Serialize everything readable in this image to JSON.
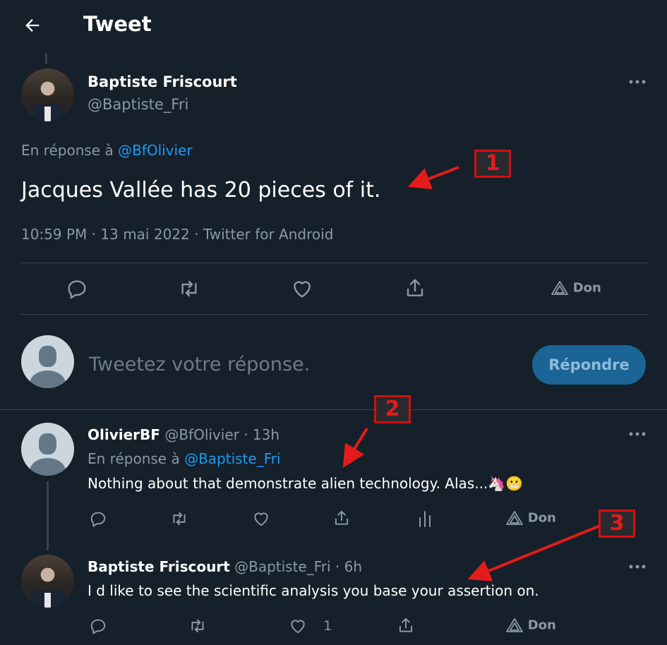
{
  "header": {
    "title": "Tweet"
  },
  "main_tweet": {
    "author_name": "Baptiste Friscourt",
    "author_handle": "@Baptiste_Fri",
    "reply_prefix": "En réponse à",
    "reply_to": "@BfOlivier",
    "text": "Jacques Vallée has 20 pieces of it.",
    "meta": "10:59 PM · 13 mai 2022 · Twitter for Android",
    "actions": {
      "tip_label": "Don"
    }
  },
  "composer": {
    "placeholder": "Tweetez votre réponse.",
    "reply_button": "Répondre"
  },
  "replies": [
    {
      "author_name": "OlivierBF",
      "author_handle": "@BfOlivier",
      "time": "· 13h",
      "reply_prefix": "En réponse à",
      "reply_to": "@Baptiste_Fri",
      "text": "Nothing about that demonstrate alien technology. Alas...",
      "emoji": "🦄😬",
      "tip_label": "Don",
      "like_count": ""
    },
    {
      "author_name": "Baptiste Friscourt",
      "author_handle": "@Baptiste_Fri",
      "time": "· 6h",
      "text": "I d like to see the scientific analysis you base your assertion on.",
      "tip_label": "Don",
      "like_count": "1"
    }
  ],
  "annotations": [
    "1",
    "2",
    "3"
  ],
  "colors": {
    "background": "#15202b",
    "accent": "#1d9bf0",
    "muted": "#8b98a5",
    "annotation": "#e31b1b"
  }
}
